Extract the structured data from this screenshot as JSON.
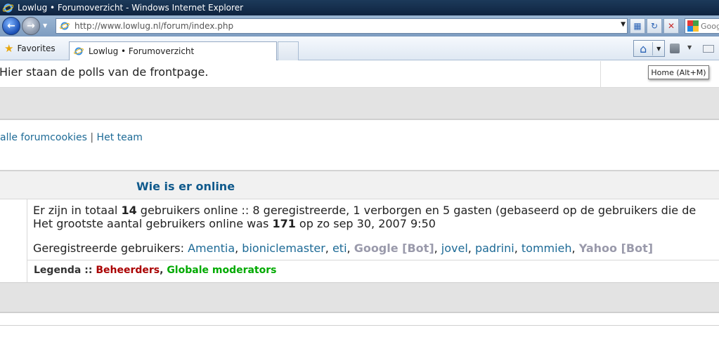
{
  "window": {
    "title": "Lowlug • Forumoverzicht - Windows Internet Explorer"
  },
  "address_bar": {
    "url": "http://www.lowlug.nl/forum/index.php",
    "search_text": "Goog"
  },
  "favorites_bar": {
    "favorites_label": "Favorites",
    "tab_title": "Lowlug • Forumoverzicht"
  },
  "tooltip": {
    "home": "Home (Alt+M)"
  },
  "page": {
    "poll_text": "Hier staan de polls van de frontpage.",
    "links": {
      "cookies": "alle forumcookies",
      "separator": " | ",
      "team": "Het team"
    },
    "who_online": {
      "title": "Wie is er online",
      "line1_pre": "Er zijn in totaal ",
      "line1_count": "14",
      "line1_post": " gebruikers online :: 8 geregistreerde, 1 verborgen en 5 gasten (gebaseerd op de gebruikers die de",
      "line2_pre": "Het grootste aantal gebruikers online was ",
      "line2_count": "171",
      "line2_post": " op zo sep 30, 2007 9:50",
      "registered_label": "Geregistreerde gebruikers: ",
      "users": [
        "Amentia",
        "bioniclemaster",
        "eti",
        "Google [Bot]",
        "jovel",
        "padrini",
        "tommieh",
        "Yahoo [Bot]"
      ],
      "legend_label": "Legenda :: ",
      "legend_admins": "Beheerders",
      "legend_sep": ", ",
      "legend_gmods": "Globale moderators"
    }
  }
}
